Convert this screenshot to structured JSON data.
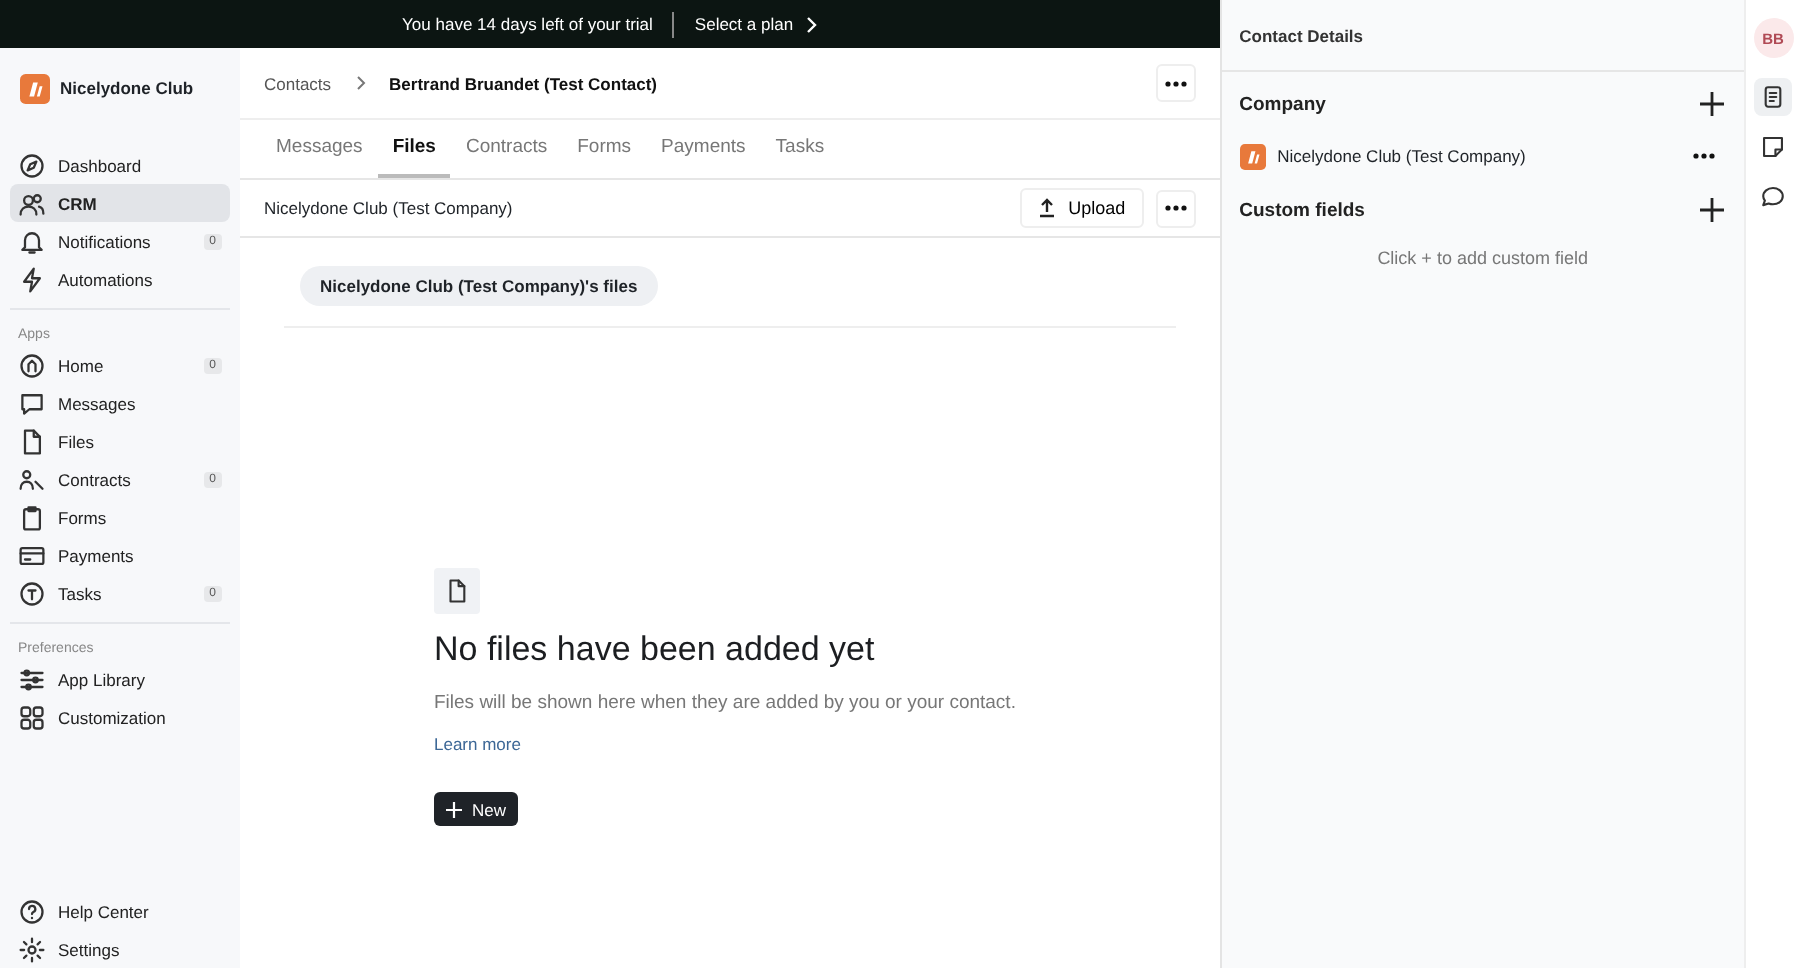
{
  "banner": {
    "message": "You have 14 days left of your trial",
    "link": "Select a plan"
  },
  "sidebar": {
    "workspace": "Nicelydone Club",
    "items": [
      {
        "label": "Dashboard",
        "selected": false
      },
      {
        "label": "CRM",
        "selected": true
      },
      {
        "label": "Notifications",
        "selected": false,
        "badge": "0"
      },
      {
        "label": "Automations",
        "selected": false
      }
    ],
    "groups": [
      {
        "title": "Apps",
        "items": [
          {
            "label": "Home",
            "selected": false,
            "badge": "0"
          },
          {
            "label": "Messages",
            "selected": false
          },
          {
            "label": "Files",
            "selected": false
          },
          {
            "label": "Contracts",
            "selected": false,
            "badge": "0"
          },
          {
            "label": "Forms",
            "selected": false
          },
          {
            "label": "Payments",
            "selected": false
          },
          {
            "label": "Tasks",
            "selected": false,
            "badge": "0"
          }
        ]
      },
      {
        "title": "Preferences",
        "items": [
          {
            "label": "App Library",
            "selected": false
          },
          {
            "label": "Customization",
            "selected": false
          }
        ]
      }
    ],
    "footer": [
      {
        "label": "Help Center",
        "selected": false
      },
      {
        "label": "Settings",
        "selected": false
      }
    ]
  },
  "breadcrumb": [
    "Contacts",
    "Bertrand Bruandet (Test Contact)"
  ],
  "tabs": [
    {
      "label": "Messages",
      "selected": false
    },
    {
      "label": "Files",
      "selected": true
    },
    {
      "label": "Contracts",
      "selected": false
    },
    {
      "label": "Forms",
      "selected": false
    },
    {
      "label": "Payments",
      "selected": false
    },
    {
      "label": "Tasks",
      "selected": false
    }
  ],
  "toolbar": {
    "company": "Nicelydone Club (Test Company)",
    "upload": "Upload"
  },
  "folder_chip": "Nicelydone Club (Test Company)'s files",
  "empty_state": {
    "title": "No files have been added yet",
    "description": "Files will be shown here when they are added by you or your contact.",
    "link": "Learn more",
    "button": "New"
  },
  "details": {
    "title": "Contact Details",
    "company_heading": "Company",
    "company": "Nicelydone Club (Test Company)",
    "custom_heading": "Custom fields",
    "custom_hint": "Click + to add custom field"
  },
  "rail": {
    "avatar": "BB",
    "tools": [
      {
        "selected": true
      },
      {
        "selected": false
      },
      {
        "selected": false
      }
    ]
  }
}
